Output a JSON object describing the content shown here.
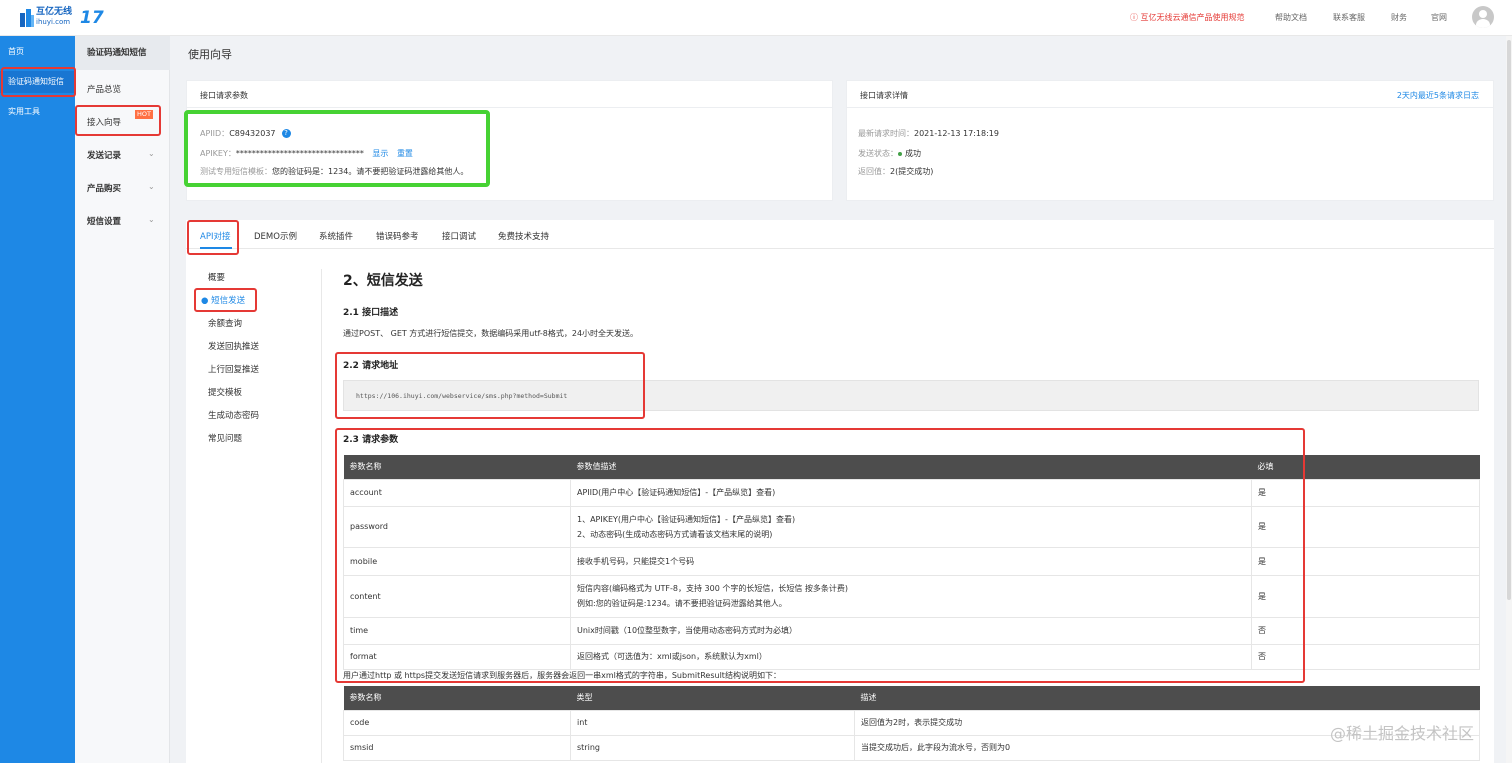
{
  "header": {
    "logo_text": "互亿无线",
    "logo_sub": "ihuyi.com",
    "logo_num": "17",
    "notice": "互亿无线云通信产品使用规范",
    "links": [
      "帮助文档",
      "联系客服",
      "财务",
      "官网"
    ]
  },
  "leftnav": {
    "items": [
      {
        "label": "首页"
      },
      {
        "label": "验证码通知短信"
      },
      {
        "label": "实用工具"
      }
    ]
  },
  "subnav": {
    "title": "验证码通知短信",
    "items": [
      {
        "label": "产品总览"
      },
      {
        "label": "接入向导",
        "badge": "HOT"
      },
      {
        "label": "发送记录"
      },
      {
        "label": "产品购买"
      },
      {
        "label": "短信设置"
      }
    ]
  },
  "page": {
    "title": "使用向导"
  },
  "params_card": {
    "title": "接口请求参数",
    "apiid_label": "APIID：",
    "apiid_value": "C89432037",
    "apikey_label": "APIKEY：",
    "apikey_value": "********************************",
    "show_link": "显示",
    "reset_link": "重置",
    "template_label": "测试专用短信模板：",
    "template_value": "您的验证码是：1234。请不要把验证码泄露给其他人。"
  },
  "detail_card": {
    "title": "接口请求详情",
    "log_link": "2天内最近5条请求日志",
    "time_label": "最新请求时间：",
    "time_value": "2021-12-13 17:18:19",
    "status_label": "发送状态：",
    "status_value": "成功",
    "return_label": "返回值：",
    "return_value": "2(提交成功)"
  },
  "tabs": [
    "API对接",
    "DEMO示例",
    "系统插件",
    "错误码参考",
    "接口调试",
    "免费技术支持"
  ],
  "inner_nav": [
    "概要",
    "短信发送",
    "余额查询",
    "发送回执推送",
    "上行回复推送",
    "提交模板",
    "生成动态密码",
    "常见问题"
  ],
  "doc": {
    "h2": "2、短信发送",
    "s21_title": "2.1 接口描述",
    "s21_text": "通过POST、 GET 方式进行短信提交，数据编码采用utf-8格式，24小时全天发送。",
    "s22_title": "2.2 请求地址",
    "url": "https://106.ihuyi.com/webservice/sms.php?method=Submit",
    "s23_title": "2.3 请求参数",
    "params_headers": [
      "参数名称",
      "参数值描述",
      "必填"
    ],
    "params_rows": [
      {
        "name": "account",
        "desc1": "APIID(用户中心【验证码通知短信】-【产品纵览】查看)",
        "desc2": "",
        "req": "是"
      },
      {
        "name": "password",
        "desc1": "1、APIKEY(用户中心【验证码通知短信】-【产品纵览】查看)",
        "desc2": "2、动态密码(生成动态密码方式请看该文档末尾的说明)",
        "req": "是"
      },
      {
        "name": "mobile",
        "desc1": "接收手机号码，只能提交1个号码",
        "desc2": "",
        "req": "是"
      },
      {
        "name": "content",
        "desc1": "短信内容(编码格式为 UTF-8，支持 300 个字的长短信，长短信 按多条计费)",
        "desc2": "例如:您的验证码是:1234。请不要把验证码泄露给其他人。",
        "req": "是"
      },
      {
        "name": "time",
        "desc1": "Unix时间戳（10位整型数字，当使用动态密码方式时为必填）",
        "desc2": "",
        "req": "否"
      },
      {
        "name": "format",
        "desc1": "返回格式（可选值为：xml或json，系统默认为xml）",
        "desc2": "",
        "req": "否"
      }
    ],
    "result_text": "用户通过http 或 https提交发送短信请求到服务器后，服务器会返回一串xml格式的字符串，SubmitResult结构说明如下：",
    "result_headers": [
      "参数名称",
      "类型",
      "描述"
    ],
    "result_rows": [
      {
        "name": "code",
        "type": "int",
        "desc": "返回值为2时，表示提交成功"
      },
      {
        "name": "smsid",
        "type": "string",
        "desc": "当提交成功后，此字段为流水号，否则为0"
      }
    ]
  },
  "watermark": "@稀土掘金技术社区",
  "colors": {
    "primary": "#1e88e5",
    "annotation_red": "#e53935",
    "annotation_green": "#46d233"
  }
}
